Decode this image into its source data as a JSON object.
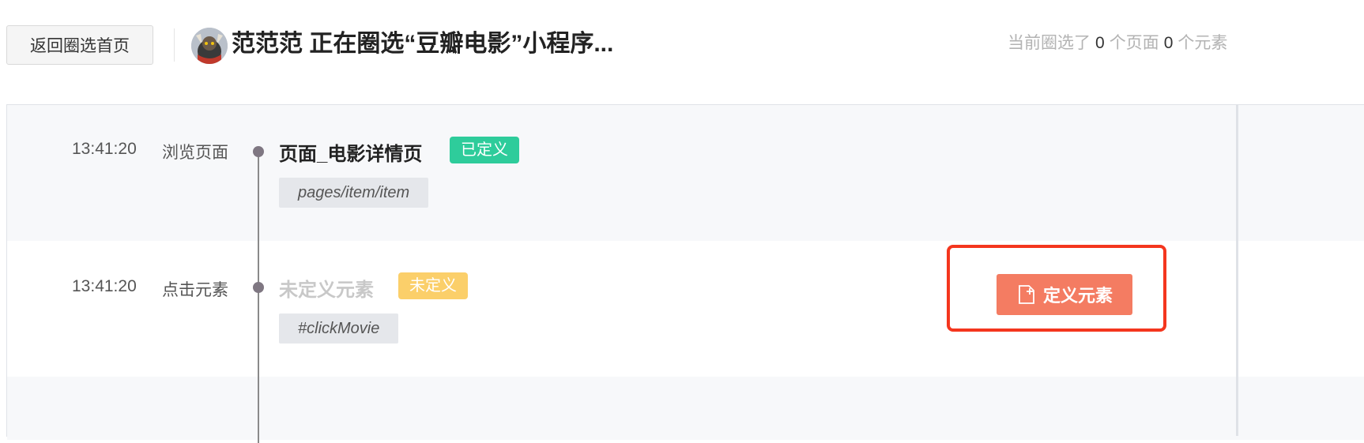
{
  "header": {
    "back_label": "返回圈选首页",
    "title": "范范范 正在圈选“豆瓣电影”小程序...",
    "summary": {
      "prefix": "当前圈选了",
      "pages_count": "0",
      "pages_unit": "个页面",
      "elements_count": "0",
      "elements_unit": "个元素"
    }
  },
  "events": [
    {
      "time": "13:41:20",
      "action": "浏览页面",
      "title": "页面_电影详情页",
      "status": "已定义",
      "path": "pages/item/item"
    },
    {
      "time": "13:41:20",
      "action": "点击元素",
      "title": "未定义元素",
      "status": "未定义",
      "path": "#clickMovie",
      "action_button": "定义元素"
    }
  ],
  "colors": {
    "defined_badge": "#2ecc9b",
    "undefined_badge": "#fbcf6a",
    "define_button": "#f47c62",
    "highlight_border": "#f4361e"
  },
  "icons": {
    "define_button_icon": "add-file-icon"
  }
}
